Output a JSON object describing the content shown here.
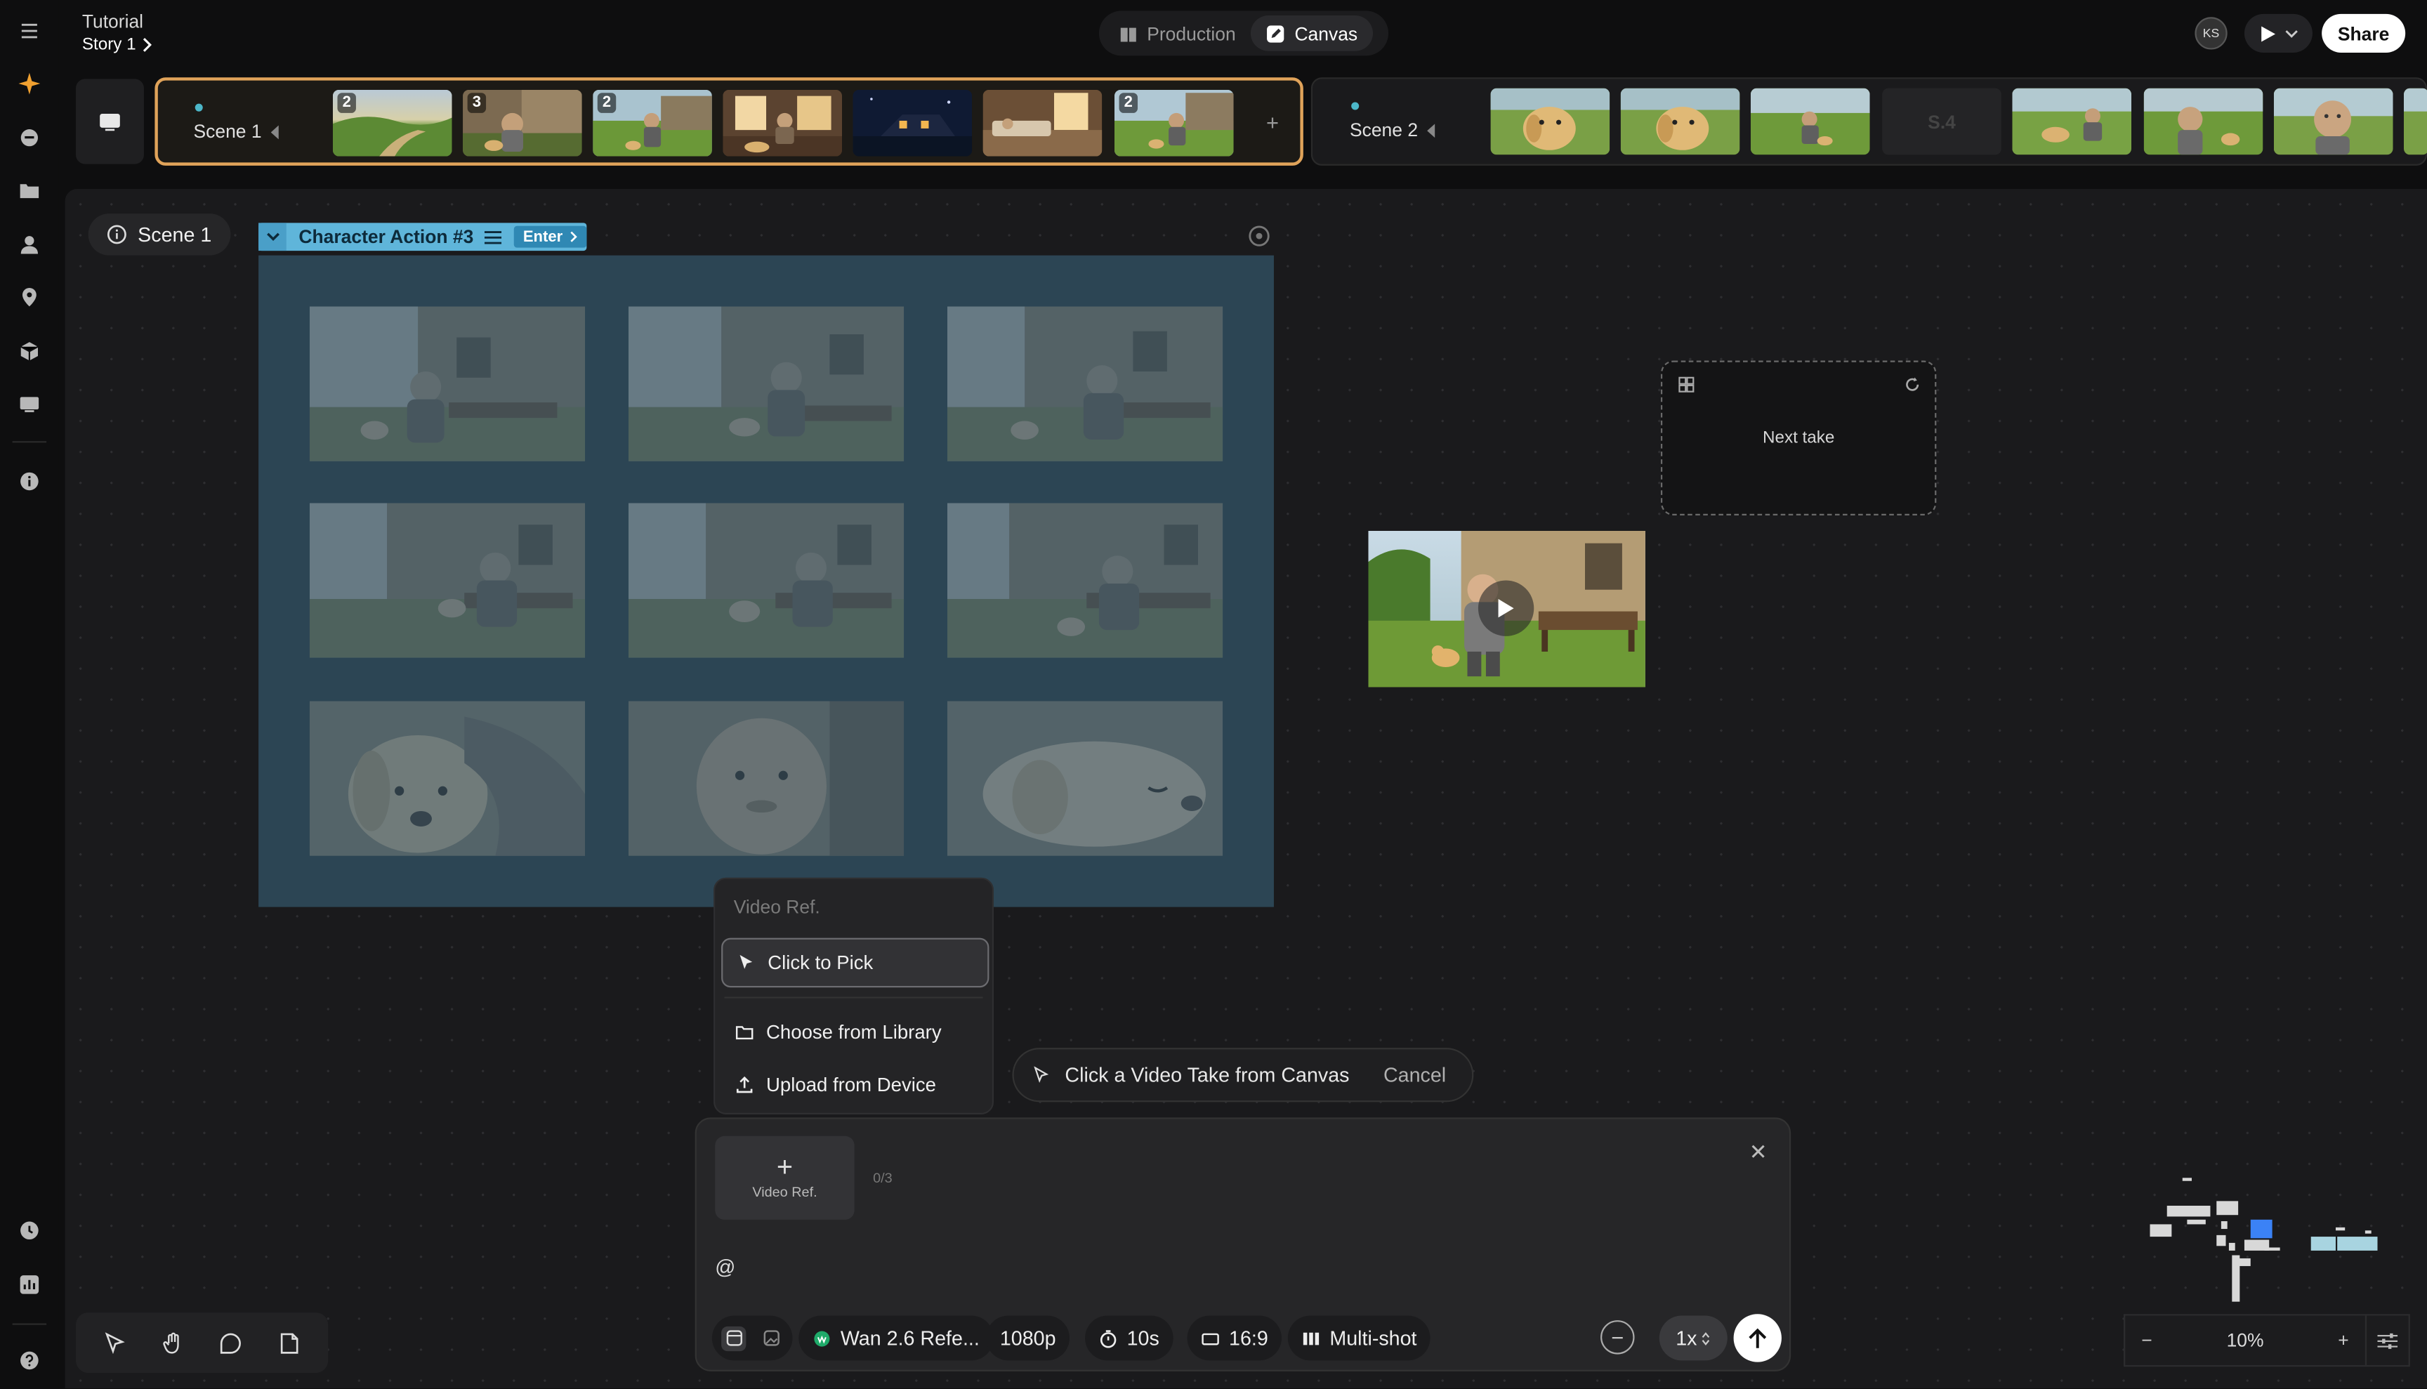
{
  "header": {
    "project": "Tutorial",
    "story": "Story 1",
    "modes": [
      {
        "label": "Production",
        "icon": "book-icon",
        "active": false
      },
      {
        "label": "Canvas",
        "icon": "edit-icon",
        "active": true
      }
    ],
    "avatar": "KS",
    "share_label": "Share"
  },
  "timeline": {
    "scenes": [
      {
        "label": "Scene 1",
        "shot_badges": [
          "2",
          "3",
          "2",
          "",
          "",
          "",
          "2"
        ]
      },
      {
        "label": "Scene 2",
        "placeholder_shot": "S.4"
      }
    ],
    "add_label": "+"
  },
  "canvas": {
    "scene_chip": "Scene 1",
    "action_tag": "Character Action #3",
    "enter_label": "Enter",
    "next_take_label": "Next take"
  },
  "menu": {
    "header": "Video Ref.",
    "items": [
      {
        "label": "Click to Pick",
        "icon": "cursor-icon"
      },
      {
        "label": "Choose from Library",
        "icon": "folder-icon"
      },
      {
        "label": "Upload from Device",
        "icon": "upload-icon"
      }
    ]
  },
  "pick_bar": {
    "label": "Click a Video Take from Canvas",
    "cancel": "Cancel"
  },
  "composer": {
    "video_ref_label": "Video Ref.",
    "count": "0/3",
    "prompt_text": "@",
    "model": "Wan 2.6 Refe...",
    "resolution": "1080p",
    "duration": "10s",
    "aspect": "16:9",
    "shot_mode": "Multi-shot",
    "speed": "1x"
  },
  "zoom": {
    "value": "10%"
  },
  "colors": {
    "accent_scene": "#e0a35a",
    "selection_blue": "#5fb5da",
    "frame_bg": "#2c4554"
  }
}
